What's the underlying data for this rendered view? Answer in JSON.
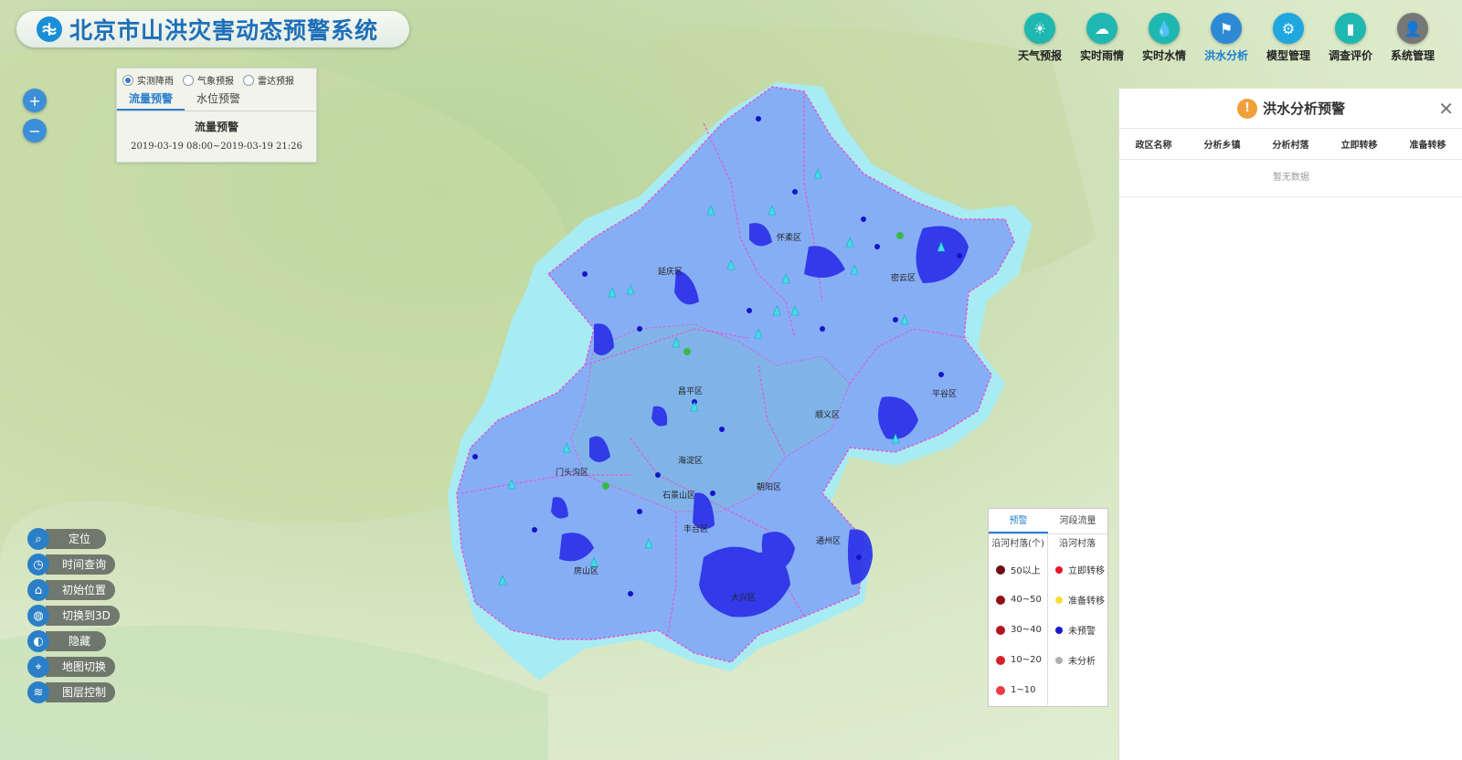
{
  "app": {
    "title": "北京市山洪灾害动态预警系统"
  },
  "nav": [
    {
      "label": "天气预报",
      "icon": "weather-icon",
      "color": "#1fb8b0"
    },
    {
      "label": "实时雨情",
      "icon": "rain-cloud-icon",
      "color": "#1fb8b0"
    },
    {
      "label": "实时水情",
      "icon": "water-drop-icon",
      "color": "#1fb8b0"
    },
    {
      "label": "洪水分析",
      "icon": "flood-analysis-icon",
      "color": "#2d8bd6",
      "active": true
    },
    {
      "label": "模型管理",
      "icon": "gear-icon",
      "color": "#1fa7e0"
    },
    {
      "label": "调查评价",
      "icon": "bar-chart-icon",
      "color": "#1fb8b0"
    },
    {
      "label": "系统管理",
      "icon": "user-admin-icon",
      "color": "#777777"
    }
  ],
  "zoom": {
    "in": "+",
    "out": "−"
  },
  "warning_panel": {
    "radios": [
      "实测降雨",
      "气象预报",
      "雷达预报"
    ],
    "selected_radio": "实测降雨",
    "tabs": [
      "流量预警",
      "水位预警"
    ],
    "active_tab": "流量预警",
    "subtitle": "流量预警",
    "time_range": "2019-03-19 08:00~2019-03-19 21:26"
  },
  "tools": [
    {
      "label": "定位",
      "icon": "search-icon"
    },
    {
      "label": "时间查询",
      "icon": "clock-icon"
    },
    {
      "label": "初始位置",
      "icon": "home-icon"
    },
    {
      "label": "切换到3D",
      "icon": "globe-icon"
    },
    {
      "label": "隐藏",
      "icon": "hide-icon"
    },
    {
      "label": "地图切换",
      "icon": "map-switch-icon"
    },
    {
      "label": "图层控制",
      "icon": "layers-icon"
    }
  ],
  "map_labels": [
    "怀柔区",
    "延庆区",
    "密云区",
    "平谷区",
    "昌平区",
    "顺义区",
    "门头沟区",
    "海淀区",
    "石景山区",
    "朝阳区",
    "丰台区",
    "通州区",
    "房山区",
    "大兴区"
  ],
  "legend": {
    "tabs": [
      "预警",
      "河段流量"
    ],
    "active_tab": "预警",
    "left_header": "沿河村落(个)",
    "right_header": "沿河村落",
    "left_items": [
      {
        "label": "50以上",
        "color": "#6e0c14"
      },
      {
        "label": "40~50",
        "color": "#8f0f1a"
      },
      {
        "label": "30~40",
        "color": "#b5121f"
      },
      {
        "label": "10~20",
        "color": "#d61f2b"
      },
      {
        "label": "1~10",
        "color": "#ee3b45"
      }
    ],
    "right_items": [
      {
        "label": "立即转移",
        "color": "#e8132a"
      },
      {
        "label": "准备转移",
        "color": "#f5de3a"
      },
      {
        "label": "未预警",
        "color": "#1a1acc"
      },
      {
        "label": "未分析",
        "color": "#b0b0b0"
      }
    ]
  },
  "side_panel": {
    "title": "洪水分析预警",
    "close": "✕",
    "columns": [
      "政区名称",
      "分析乡镇",
      "分析村落",
      "立即转移",
      "准备转移"
    ],
    "empty_text": "暂无数据"
  }
}
